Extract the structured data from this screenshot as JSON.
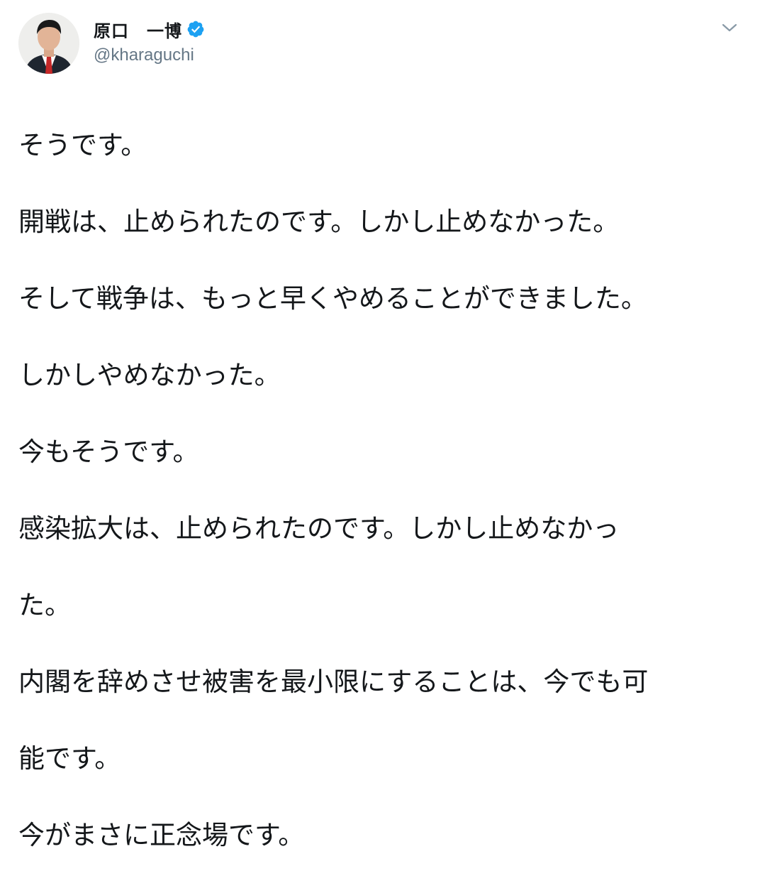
{
  "author": {
    "display_name": "原口　一博",
    "handle": "@kharaguchi",
    "verified": true,
    "avatar_icon": "profile-photo",
    "verified_icon": "verified-badge-icon",
    "caret_icon": "chevron-down-icon"
  },
  "colors": {
    "text": "#14171a",
    "secondary": "#657786",
    "verified_blue": "#1da1f2"
  },
  "tweet": {
    "lines": [
      "そうです。",
      "開戦は、止められたのです。しかし止めなかった。",
      "そして戦争は、もっと早くやめることができました。",
      "しかしやめなかった。",
      "今もそうです。",
      "感染拡大は、止められたのです。しかし止めなかっ",
      "た。",
      "内閣を辞めさせ被害を最小限にすることは、今でも可",
      "能です。",
      "今がまさに正念場です。"
    ]
  }
}
